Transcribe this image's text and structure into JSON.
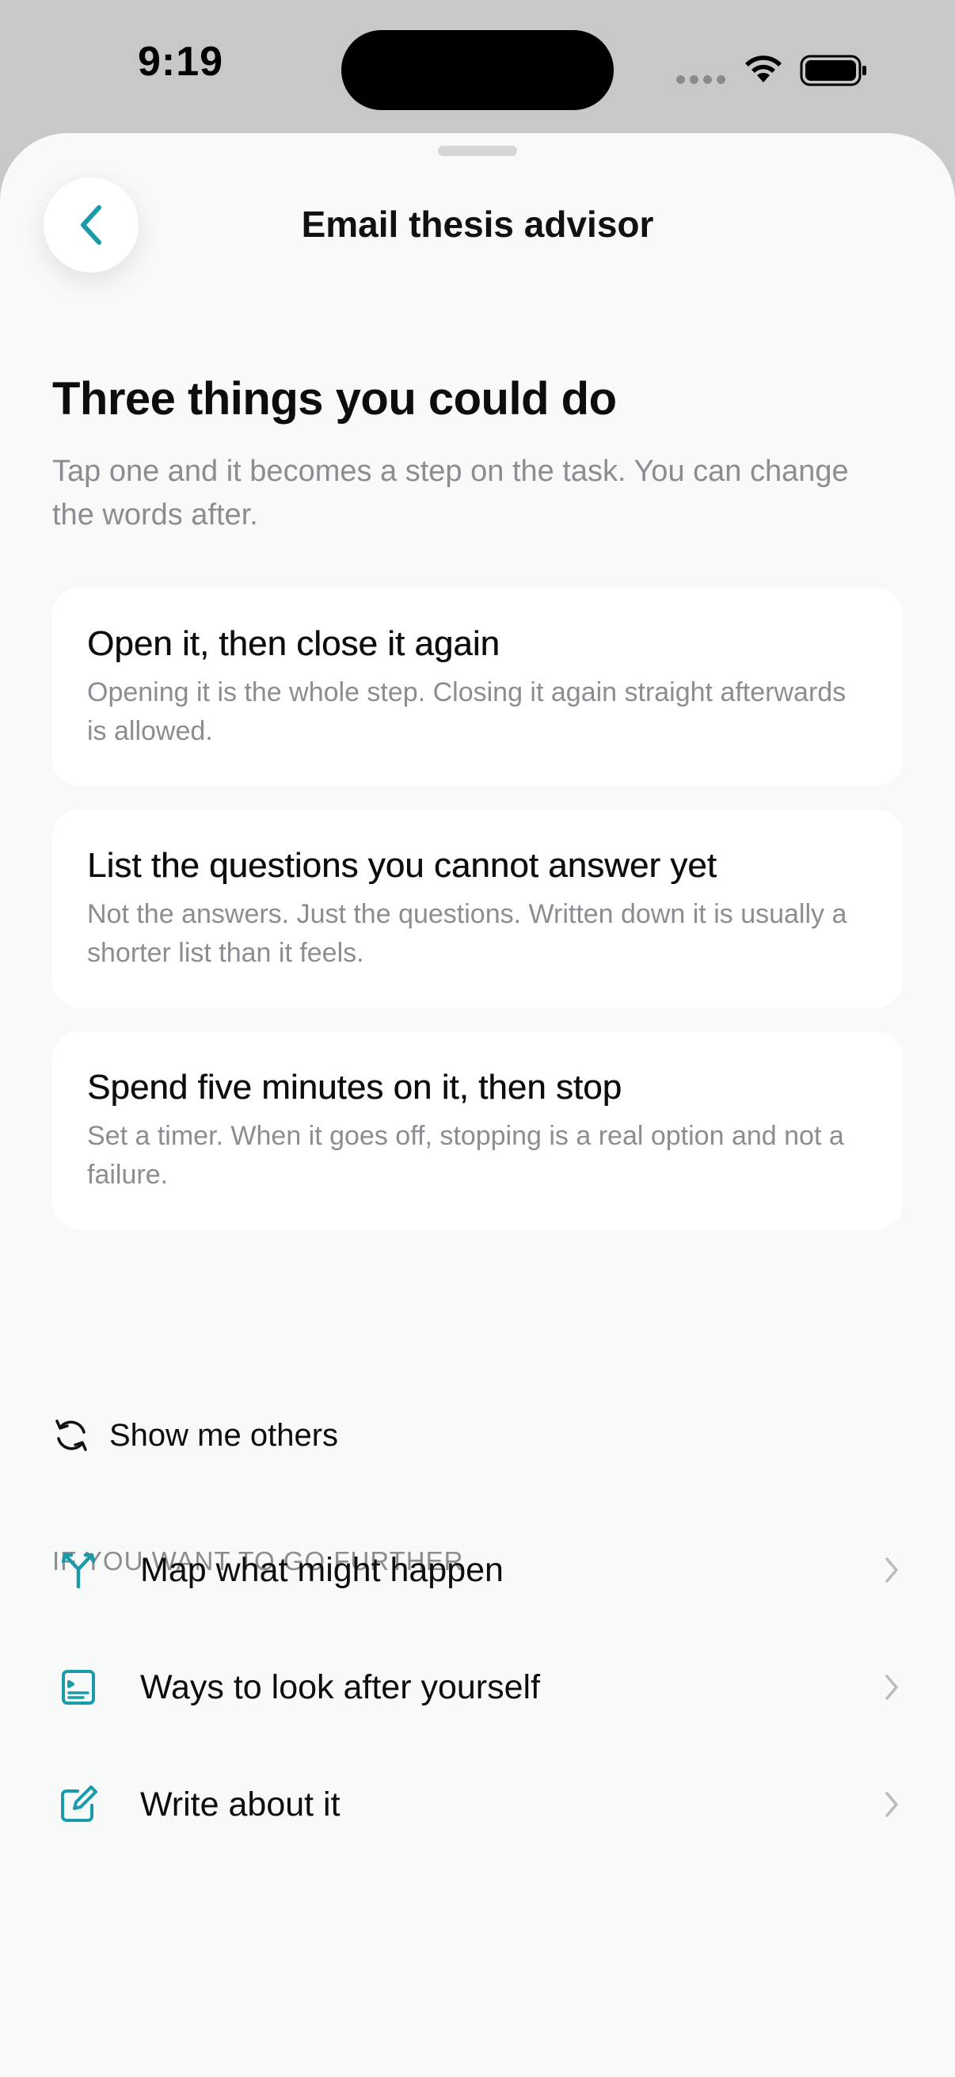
{
  "status_bar": {
    "time": "9:19"
  },
  "header": {
    "title": "Email thesis advisor",
    "back_icon": "chevron-left-icon"
  },
  "intro": {
    "heading": "Three things you could do",
    "subheading": "Tap one and it becomes a step on the task. You can change the words after."
  },
  "options": [
    {
      "title": "Open it, then close it again",
      "body": "Opening it is the whole step. Closing it again straight afterwards is allowed."
    },
    {
      "title": "List the questions you cannot answer yet",
      "body": "Not the answers. Just the questions. Written down it is usually a shorter list than it feels."
    },
    {
      "title": "Spend five minutes on it, then stop",
      "body": "Set a timer. When it goes off, stopping is a real option and not a failure."
    }
  ],
  "others": {
    "label": "Show me others",
    "icon": "refresh-icon"
  },
  "further": {
    "section_label": "IF YOU WANT TO GO FURTHER",
    "items": [
      {
        "label": "Map what might happen",
        "icon": "branch-icon"
      },
      {
        "label": "Ways to look after yourself",
        "icon": "card-icon"
      },
      {
        "label": "Write about it",
        "icon": "edit-icon"
      }
    ]
  },
  "colors": {
    "accent": "#1b9aa8",
    "sheet_background": "#f8f9f9",
    "card_background": "#ffffff",
    "secondary_text": "#8a8d92"
  }
}
